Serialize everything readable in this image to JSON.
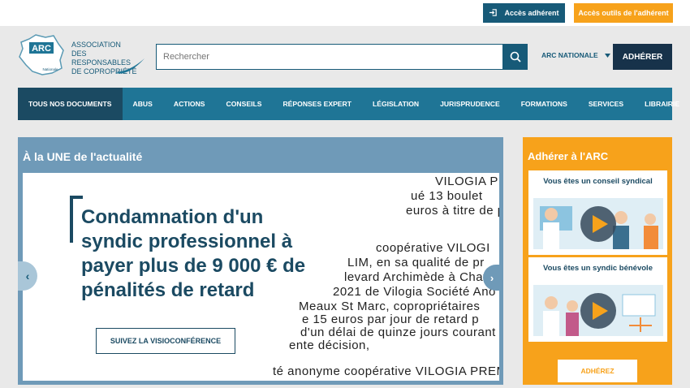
{
  "topbar": {
    "adherent_label": "Accès adhérent",
    "outils_label": "Accès outils de l'adhérent"
  },
  "header": {
    "logo_line1": "ASSOCIATION",
    "logo_line2": "DES RESPONSABLES",
    "logo_line3": "DE COPROPRIÉTÉ",
    "logo_badge": "ARC",
    "logo_sub": "Nationale",
    "search_placeholder": "Rechercher",
    "region_label": "ARC NATIONALE",
    "adherer_label": "ADHÉRER"
  },
  "nav": {
    "items": [
      {
        "label": "TOUS NOS DOCUMENTS"
      },
      {
        "label": "ABUS"
      },
      {
        "label": "ACTIONS"
      },
      {
        "label": "CONSEILS"
      },
      {
        "label": "RÉPONSES EXPERT"
      },
      {
        "label": "LÉGISLATION"
      },
      {
        "label": "JURISPRUDENCE"
      },
      {
        "label": "FORMATIONS"
      },
      {
        "label": "SERVICES"
      },
      {
        "label": "LIBRAIRIE"
      }
    ]
  },
  "une": {
    "title": "À la UNE de l'actualité",
    "headline": "Condamnation d'un syndic professionnel à payer plus de 9 000 € de pénalités de retard",
    "cta_label": "SUIVEZ LA VISIOCONFÉRENCE",
    "doc_lines": [
      "VILOGIA PREI",
      "ué 13 boulet",
      "euros à titre de p",
      "coopérative  VILOGI",
      "LIM, en sa qualité de pr",
      "levard Archimède à Chat",
      "2021 de Vilogia Société Ano",
      "Meaux St Marc, copropriétaires",
      "e 15 euros par jour de retard p",
      "d'un délai de quinze jours courant",
      "ente décision,",
      "té anonyme coopérative VILOGIA PREM"
    ]
  },
  "side": {
    "title": "Adhérer à l'ARC",
    "card1_label": "Vous êtes un conseil syndical",
    "card2_label": "Vous êtes un syndic bénévole",
    "adherez_label": "ADHÉREZ"
  },
  "colors": {
    "primary": "#175a78",
    "nav": "#1f7596",
    "nav_active": "#1b4a62",
    "accent": "#f7a21b",
    "une_bg": "#6f9ab8"
  }
}
